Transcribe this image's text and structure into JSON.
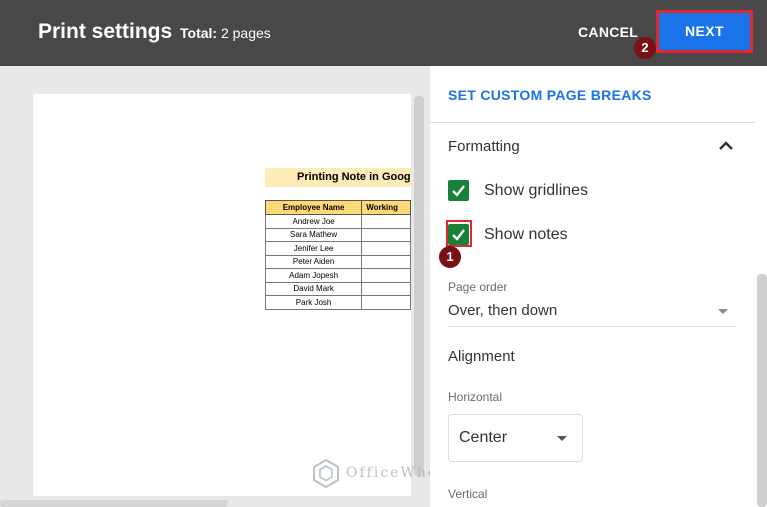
{
  "header": {
    "title": "Print settings",
    "total_label": "Total:",
    "total_count": "2 pages",
    "cancel_label": "CANCEL",
    "next_label": "NEXT",
    "marker_next": "2"
  },
  "preview": {
    "sheet_title": "Printing Note in Goog",
    "columns": [
      "Employee Name",
      "Working"
    ],
    "rows": [
      "Andrew Joe",
      "Sara Mathew",
      "Jenifer Lee",
      "Peter Aiden",
      "Adam Jopesh",
      "David Mark",
      "Park Josh"
    ],
    "watermark": "OfficeWheel"
  },
  "panel": {
    "custom_breaks_label": "SET CUSTOM PAGE BREAKS",
    "formatting_label": "Formatting",
    "show_gridlines_label": "Show gridlines",
    "show_gridlines_checked": true,
    "show_notes_label": "Show notes",
    "show_notes_checked": true,
    "marker_notes": "1",
    "page_order_label": "Page order",
    "page_order_value": "Over, then down",
    "alignment_label": "Alignment",
    "horizontal_label": "Horizontal",
    "horizontal_value": "Center",
    "vertical_label": "Vertical"
  },
  "colors": {
    "header_bg": "#484848",
    "accent_blue": "#1a73e8",
    "checkbox_green": "#188038",
    "highlight_red": "#e0282e",
    "marker_maroon": "#7a0f14"
  }
}
